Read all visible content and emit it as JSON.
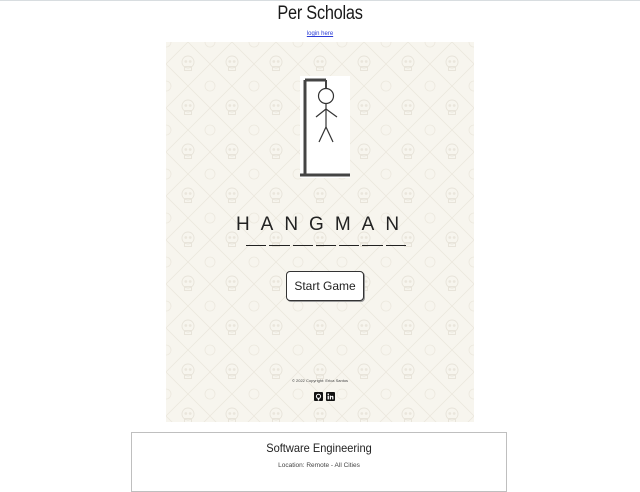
{
  "header": {
    "site_title": "Per Scholas",
    "login_link": "login here"
  },
  "game": {
    "title": "HANGMAN",
    "blank_count": 7,
    "start_button": "Start Game",
    "copyright": "© 2022 Copyright: Erica Santos",
    "social_icons": [
      "github-icon",
      "linkedin-icon"
    ]
  },
  "job_card": {
    "title": "Software Engineering",
    "location": "Location: Remote - All Cities"
  },
  "colors": {
    "panel_background": "#f7f5ee",
    "pattern": "#e7e3d9",
    "link": "#2a3bd6",
    "gallows": "#444444"
  }
}
